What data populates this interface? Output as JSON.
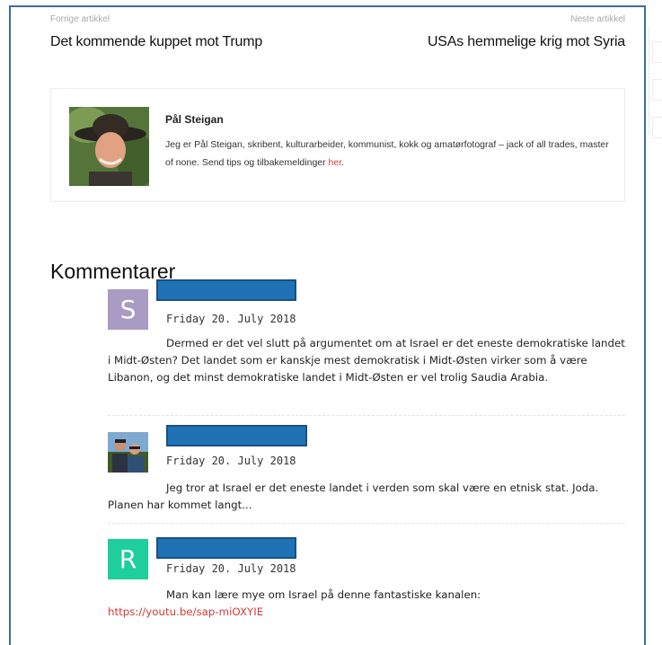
{
  "post_nav": {
    "prev_label": "Forrige artikkel",
    "prev_title": "Det kommende kuppet mot Trump",
    "next_label": "Neste artikkel",
    "next_title": "USAs hemmelige krig mot Syria"
  },
  "author": {
    "name": "Pål Steigan",
    "bio_text": "Jeg er Pål Steigan, skribent, kulturarbeider, kommunist, kokk og amatørfotograf – jack of all trades, master of none. Send tips og tilbakemeldinger ",
    "bio_link": "her",
    "bio_end": "."
  },
  "comments_heading": "Kommentarer",
  "comments": [
    {
      "avatar_letter": "S",
      "avatar_color": "#a99bc4",
      "date": "Friday 20. July 2018",
      "body": "Dermed er det vel slutt på argumentet om at Israel er det eneste demokratiske landet i Midt-Østen? Det landet som er kanskje mest demokratisk i Midt-Østen virker som å være Libanon, og det minst demokratiske landet i Midt-Østen er vel trolig Saudia Arabia."
    },
    {
      "avatar_letter": "",
      "avatar_color": "",
      "date": "Friday 20. July 2018",
      "body": "Jeg tror at Israel er det eneste landet i verden som skal være en etnisk stat. Joda. Planen har kommet langt..."
    },
    {
      "avatar_letter": "R",
      "avatar_color": "#1fcf9b",
      "date": "Friday 20. July 2018",
      "body": "Man kan lære mye om Israel på denne fantastiske kanalen:",
      "link": "https://youtu.be/sap-miOXYIE"
    }
  ]
}
